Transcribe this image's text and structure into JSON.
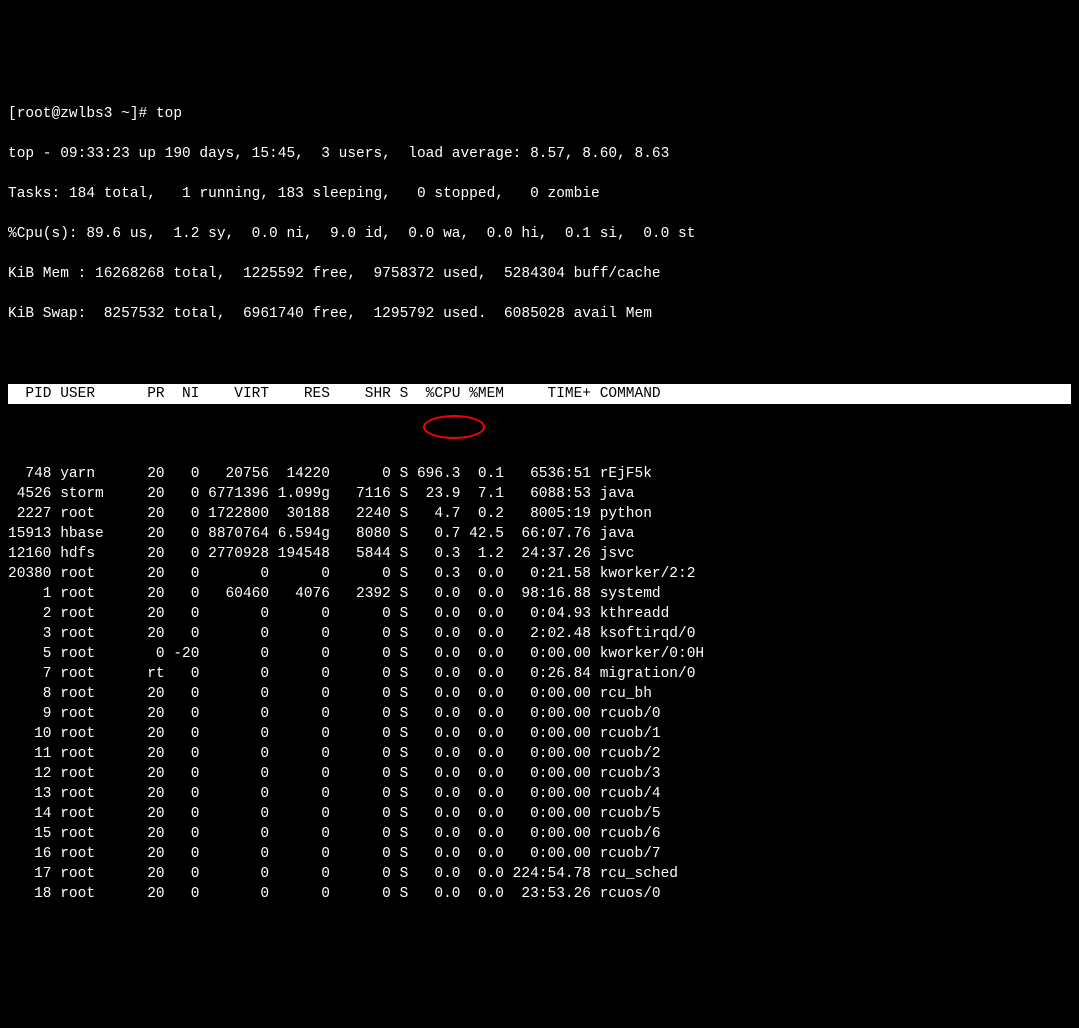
{
  "prompt": "[root@zwlbs3 ~]# ",
  "command": "top",
  "summary": {
    "line1": "top - 09:33:23 up 190 days, 15:45,  3 users,  load average: 8.57, 8.60, 8.63",
    "line2": "Tasks: 184 total,   1 running, 183 sleeping,   0 stopped,   0 zombie",
    "line3": "%Cpu(s): 89.6 us,  1.2 sy,  0.0 ni,  9.0 id,  0.0 wa,  0.0 hi,  0.1 si,  0.0 st",
    "line4": "KiB Mem : 16268268 total,  1225592 free,  9758372 used,  5284304 buff/cache",
    "line5": "KiB Swap:  8257532 total,  6961740 free,  1295792 used.  6085028 avail Mem"
  },
  "headers": "  PID USER      PR  NI    VIRT    RES    SHR S  %CPU %MEM     TIME+ COMMAND                                     ",
  "processes": [
    {
      "pid": "748",
      "user": "yarn",
      "pr": "20",
      "ni": "0",
      "virt": "20756",
      "res": "14220",
      "shr": "0",
      "s": "S",
      "cpu": "696.3",
      "mem": "0.1",
      "time": "6536:51",
      "cmd": "rEjF5k"
    },
    {
      "pid": "4526",
      "user": "storm",
      "pr": "20",
      "ni": "0",
      "virt": "6771396",
      "res": "1.099g",
      "shr": "7116",
      "s": "S",
      "cpu": "23.9",
      "mem": "7.1",
      "time": "6088:53",
      "cmd": "java"
    },
    {
      "pid": "2227",
      "user": "root",
      "pr": "20",
      "ni": "0",
      "virt": "1722800",
      "res": "30188",
      "shr": "2240",
      "s": "S",
      "cpu": "4.7",
      "mem": "0.2",
      "time": "8005:19",
      "cmd": "python"
    },
    {
      "pid": "15913",
      "user": "hbase",
      "pr": "20",
      "ni": "0",
      "virt": "8870764",
      "res": "6.594g",
      "shr": "8080",
      "s": "S",
      "cpu": "0.7",
      "mem": "42.5",
      "time": "66:07.76",
      "cmd": "java"
    },
    {
      "pid": "12160",
      "user": "hdfs",
      "pr": "20",
      "ni": "0",
      "virt": "2770928",
      "res": "194548",
      "shr": "5844",
      "s": "S",
      "cpu": "0.3",
      "mem": "1.2",
      "time": "24:37.26",
      "cmd": "jsvc"
    },
    {
      "pid": "20380",
      "user": "root",
      "pr": "20",
      "ni": "0",
      "virt": "0",
      "res": "0",
      "shr": "0",
      "s": "S",
      "cpu": "0.3",
      "mem": "0.0",
      "time": "0:21.58",
      "cmd": "kworker/2:2"
    },
    {
      "pid": "1",
      "user": "root",
      "pr": "20",
      "ni": "0",
      "virt": "60460",
      "res": "4076",
      "shr": "2392",
      "s": "S",
      "cpu": "0.0",
      "mem": "0.0",
      "time": "98:16.88",
      "cmd": "systemd"
    },
    {
      "pid": "2",
      "user": "root",
      "pr": "20",
      "ni": "0",
      "virt": "0",
      "res": "0",
      "shr": "0",
      "s": "S",
      "cpu": "0.0",
      "mem": "0.0",
      "time": "0:04.93",
      "cmd": "kthreadd"
    },
    {
      "pid": "3",
      "user": "root",
      "pr": "20",
      "ni": "0",
      "virt": "0",
      "res": "0",
      "shr": "0",
      "s": "S",
      "cpu": "0.0",
      "mem": "0.0",
      "time": "2:02.48",
      "cmd": "ksoftirqd/0"
    },
    {
      "pid": "5",
      "user": "root",
      "pr": "0",
      "ni": "-20",
      "virt": "0",
      "res": "0",
      "shr": "0",
      "s": "S",
      "cpu": "0.0",
      "mem": "0.0",
      "time": "0:00.00",
      "cmd": "kworker/0:0H"
    },
    {
      "pid": "7",
      "user": "root",
      "pr": "rt",
      "ni": "0",
      "virt": "0",
      "res": "0",
      "shr": "0",
      "s": "S",
      "cpu": "0.0",
      "mem": "0.0",
      "time": "0:26.84",
      "cmd": "migration/0"
    },
    {
      "pid": "8",
      "user": "root",
      "pr": "20",
      "ni": "0",
      "virt": "0",
      "res": "0",
      "shr": "0",
      "s": "S",
      "cpu": "0.0",
      "mem": "0.0",
      "time": "0:00.00",
      "cmd": "rcu_bh"
    },
    {
      "pid": "9",
      "user": "root",
      "pr": "20",
      "ni": "0",
      "virt": "0",
      "res": "0",
      "shr": "0",
      "s": "S",
      "cpu": "0.0",
      "mem": "0.0",
      "time": "0:00.00",
      "cmd": "rcuob/0"
    },
    {
      "pid": "10",
      "user": "root",
      "pr": "20",
      "ni": "0",
      "virt": "0",
      "res": "0",
      "shr": "0",
      "s": "S",
      "cpu": "0.0",
      "mem": "0.0",
      "time": "0:00.00",
      "cmd": "rcuob/1"
    },
    {
      "pid": "11",
      "user": "root",
      "pr": "20",
      "ni": "0",
      "virt": "0",
      "res": "0",
      "shr": "0",
      "s": "S",
      "cpu": "0.0",
      "mem": "0.0",
      "time": "0:00.00",
      "cmd": "rcuob/2"
    },
    {
      "pid": "12",
      "user": "root",
      "pr": "20",
      "ni": "0",
      "virt": "0",
      "res": "0",
      "shr": "0",
      "s": "S",
      "cpu": "0.0",
      "mem": "0.0",
      "time": "0:00.00",
      "cmd": "rcuob/3"
    },
    {
      "pid": "13",
      "user": "root",
      "pr": "20",
      "ni": "0",
      "virt": "0",
      "res": "0",
      "shr": "0",
      "s": "S",
      "cpu": "0.0",
      "mem": "0.0",
      "time": "0:00.00",
      "cmd": "rcuob/4"
    },
    {
      "pid": "14",
      "user": "root",
      "pr": "20",
      "ni": "0",
      "virt": "0",
      "res": "0",
      "shr": "0",
      "s": "S",
      "cpu": "0.0",
      "mem": "0.0",
      "time": "0:00.00",
      "cmd": "rcuob/5"
    },
    {
      "pid": "15",
      "user": "root",
      "pr": "20",
      "ni": "0",
      "virt": "0",
      "res": "0",
      "shr": "0",
      "s": "S",
      "cpu": "0.0",
      "mem": "0.0",
      "time": "0:00.00",
      "cmd": "rcuob/6"
    },
    {
      "pid": "16",
      "user": "root",
      "pr": "20",
      "ni": "0",
      "virt": "0",
      "res": "0",
      "shr": "0",
      "s": "S",
      "cpu": "0.0",
      "mem": "0.0",
      "time": "0:00.00",
      "cmd": "rcuob/7"
    },
    {
      "pid": "17",
      "user": "root",
      "pr": "20",
      "ni": "0",
      "virt": "0",
      "res": "0",
      "shr": "0",
      "s": "S",
      "cpu": "0.0",
      "mem": "0.0",
      "time": "224:54.78",
      "cmd": "rcu_sched"
    },
    {
      "pid": "18",
      "user": "root",
      "pr": "20",
      "ni": "0",
      "virt": "0",
      "res": "0",
      "shr": "0",
      "s": "S",
      "cpu": "0.0",
      "mem": "0.0",
      "time": "23:53.26",
      "cmd": "rcuos/0"
    }
  ],
  "annotation": {
    "target": "cpu-column-first-row"
  }
}
